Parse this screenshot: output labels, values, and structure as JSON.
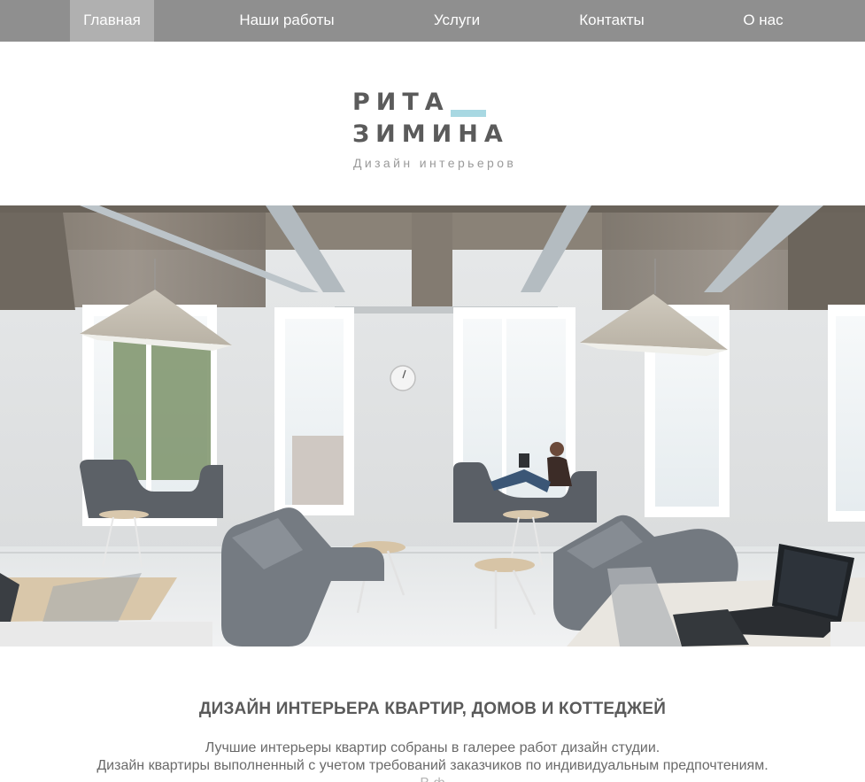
{
  "nav": {
    "items": [
      {
        "label": "Главная",
        "active": true
      },
      {
        "label": "Наши работы",
        "active": false
      },
      {
        "label": "Услуги",
        "active": false
      },
      {
        "label": "Контакты",
        "active": false
      },
      {
        "label": "О нас",
        "active": false
      }
    ]
  },
  "logo": {
    "line1": "РИТА",
    "line2": "ЗИМИНА",
    "subtitle": "Дизайн интерьеров"
  },
  "content": {
    "headline": "ДИЗАЙН ИНТЕРЬЕРА КВАРТИР, ДОМОВ И КОТТЕДЖЕЙ",
    "paragraph_lines": [
      "Лучшие интерьеры квартир собраны в галерее работ дизайн студии.",
      "Дизайн квартиры выполненный с учетом требований заказчиков по индивидуальным предпочтениям.",
      "В                                                         ф"
    ]
  },
  "colors": {
    "nav_bg": "#8f8f8f",
    "nav_active_bg": "#b0b0b0",
    "accent": "#a8d8e2"
  }
}
